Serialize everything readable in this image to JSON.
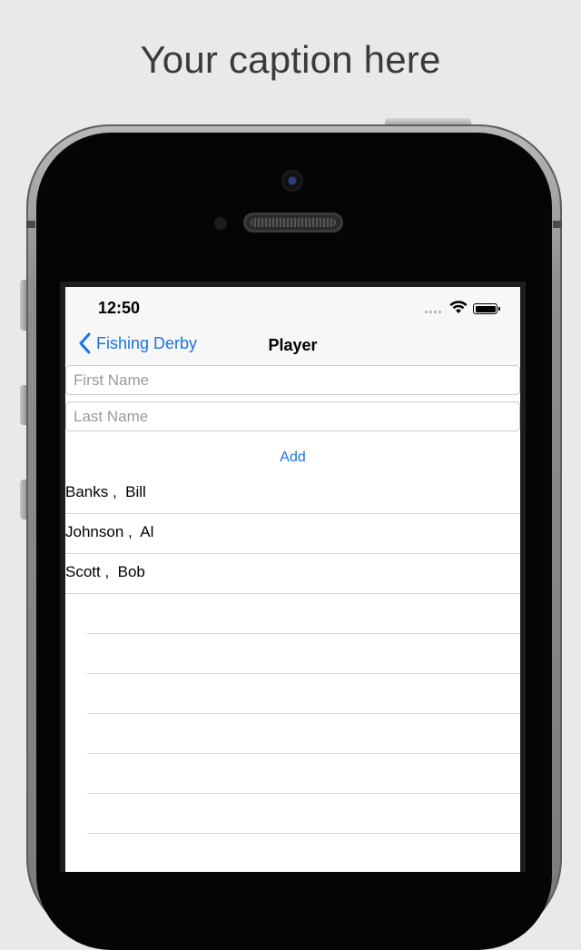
{
  "caption": "Your caption here",
  "status_bar": {
    "time": "12:50"
  },
  "nav": {
    "back_label": "Fishing Derby",
    "title": "Player"
  },
  "form": {
    "first_name_placeholder": "First Name",
    "last_name_placeholder": "Last Name",
    "first_name_value": "",
    "last_name_value": "",
    "add_label": "Add"
  },
  "players": [
    "Banks ,  Bill",
    "Johnson ,  Al",
    "Scott ,  Bob"
  ],
  "empty_rows": 7,
  "colors": {
    "accent": "#1a73e8",
    "background": "#e9e9e9",
    "separator": "#d6d6d6"
  }
}
